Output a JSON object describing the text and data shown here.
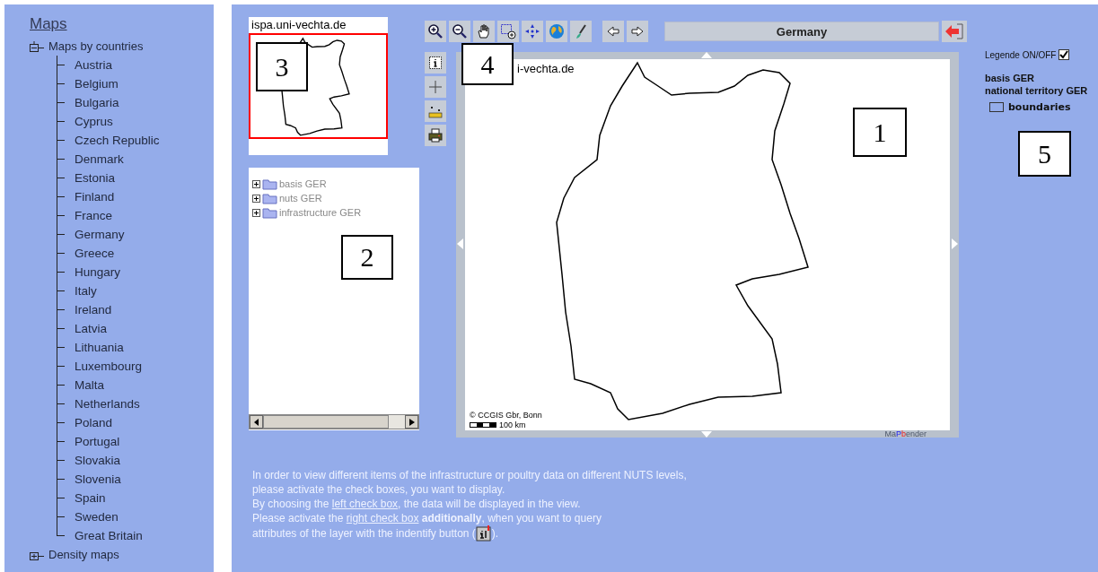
{
  "sidebar": {
    "title": "Maps",
    "groups": [
      {
        "label": "Maps by countries",
        "expanded": true,
        "children": [
          {
            "label": "Austria"
          },
          {
            "label": "Belgium"
          },
          {
            "label": "Bulgaria"
          },
          {
            "label": "Cyprus"
          },
          {
            "label": "Czech Republic"
          },
          {
            "label": "Denmark"
          },
          {
            "label": "Estonia"
          },
          {
            "label": "Finland"
          },
          {
            "label": "France"
          },
          {
            "label": "Germany"
          },
          {
            "label": "Greece"
          },
          {
            "label": "Hungary"
          },
          {
            "label": "Italy"
          },
          {
            "label": "Ireland"
          },
          {
            "label": "Latvia"
          },
          {
            "label": "Lithuania"
          },
          {
            "label": "Luxembourg"
          },
          {
            "label": "Malta"
          },
          {
            "label": "Netherlands"
          },
          {
            "label": "Poland"
          },
          {
            "label": "Portugal"
          },
          {
            "label": "Slovakia"
          },
          {
            "label": "Slovenia"
          },
          {
            "label": "Spain"
          },
          {
            "label": "Sweden"
          },
          {
            "label": "Great Britain"
          }
        ]
      },
      {
        "label": "Density maps",
        "expanded": false
      }
    ]
  },
  "overview": {
    "title": "ispa.uni-vechta.de"
  },
  "layer_tree": {
    "items": [
      {
        "label": "basis GER",
        "expanded": false
      },
      {
        "label": "nuts GER",
        "expanded": false
      },
      {
        "label": "infrastructure GER",
        "expanded": false
      }
    ]
  },
  "toolbar": {
    "location": "Germany"
  },
  "map": {
    "label": "i-vechta.de",
    "copyright": "© CCGIS Gbr, Bonn",
    "scale": "100 km",
    "logo": [
      "Ma",
      "P",
      "b",
      "ender"
    ]
  },
  "legend": {
    "toggle_label": "Legende ON/OFF",
    "checked": true,
    "group": "basis GER",
    "layer": "national territory GER",
    "entries": [
      {
        "label": "boundaries"
      }
    ]
  },
  "instructions": [
    [
      {
        "kind": "text",
        "text": "In order to view different items of the infrastructure or poultry data on different NUTS levels,"
      }
    ],
    [
      {
        "kind": "text",
        "text": "please activate the check boxes, you want to display."
      }
    ],
    [
      {
        "kind": "text",
        "text": "By choosing the "
      },
      {
        "kind": "link",
        "text": "left check box"
      },
      {
        "kind": "text",
        "text": ", the data will be displayed in the view."
      }
    ],
    [
      {
        "kind": "text",
        "text": "Please activate the "
      },
      {
        "kind": "link",
        "text": "right check box"
      },
      {
        "kind": "bold",
        "text": " additionally"
      },
      {
        "kind": "text",
        "text": ", when you want to query"
      }
    ],
    [
      {
        "kind": "text",
        "text": "attributes of the layer with the indentify button ("
      },
      {
        "kind": "icon"
      },
      {
        "kind": "text",
        "text": ")."
      }
    ]
  ],
  "callouts": [
    "1",
    "2",
    "3",
    "4",
    "5"
  ]
}
